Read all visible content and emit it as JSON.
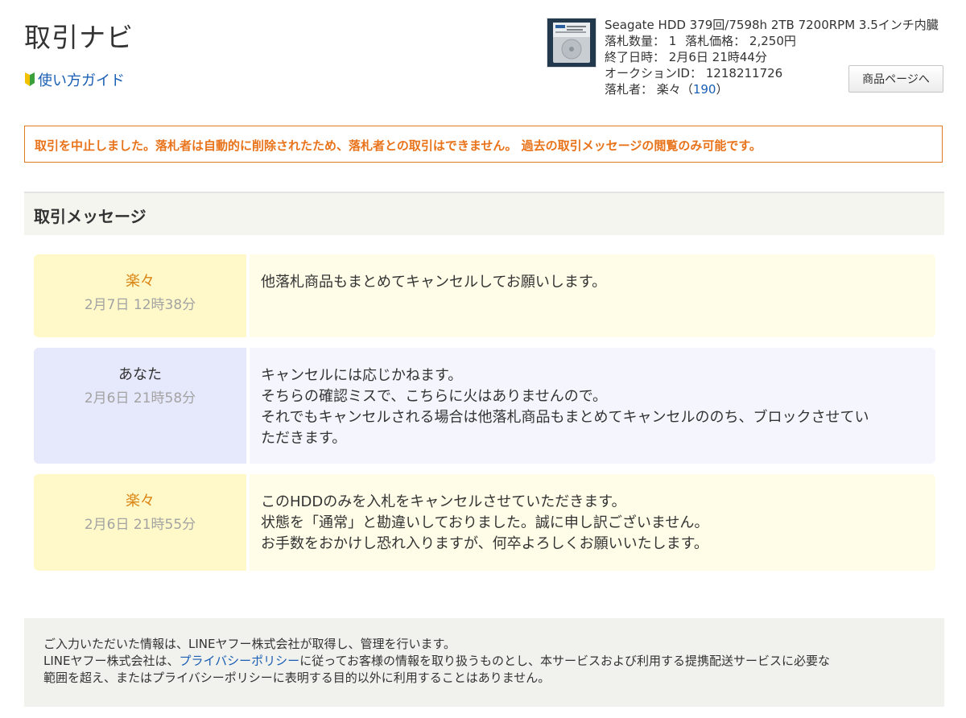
{
  "page": {
    "title": "取引ナビ",
    "guide_link": "使い方ガイド"
  },
  "product": {
    "name": "Seagate HDD 379回/7598h 2TB 7200RPM 3.5インチ内臓",
    "quantity_label": "落札数量：",
    "quantity_value": "1",
    "price_label": "落札価格：",
    "price_value": "2,250円",
    "end_label": "終了日時：",
    "end_value": "2月6日 21時44分",
    "auction_id_label": "オークションID：",
    "auction_id_value": "1218211726",
    "winner_label": "落札者：",
    "winner_name": "楽々",
    "winner_score": "190",
    "item_page_button": "商品ページへ",
    "thumbnail_icon": "hard-drive-image"
  },
  "alert": {
    "text": "取引を中止しました。落札者は自動的に削除されたため、落札者との取引はできません。 過去の取引メッセージの閲覧のみ可能です。",
    "color": "#e8731a"
  },
  "messages_section": {
    "title": "取引メッセージ",
    "items": [
      {
        "sender": "楽々",
        "date": "2月7日 12時38分",
        "lines": [
          "他落札商品もまとめてキャンセルしてお願いします。"
        ]
      },
      {
        "sender": "あなた",
        "date": "2月6日 21時58分",
        "lines": [
          "キャンセルには応じかねます。",
          "そちらの確認ミスで、こちらに火はありませんので。",
          "それでもキャンセルされる場合は他落札商品もまとめてキャンセルののち、ブロックさせてい",
          "ただきます。"
        ]
      },
      {
        "sender": "楽々",
        "date": "2月6日 21時55分",
        "lines": [
          "このHDDのみを入札をキャンセルさせていただきます。",
          "状態を「通常」と勘違いしておりました。誠に申し訳ございません。",
          "お手数をおかけし恐れ入りますが、何卒よろしくお願いいたします。"
        ]
      }
    ]
  },
  "footer": {
    "line1": "ご入力いただいた情報は、LINEヤフー株式会社が取得し、管理を行います。",
    "line2_before": "LINEヤフー株式会社は、",
    "privacy_link": "プライバシーポリシー",
    "line2_after": "に従ってお客様の情報を取り扱うものとし、本サービスおよび利用する提携配送サービスに必要な",
    "line3": "範囲を超え、またはプライバシーポリシーに表明する目的以外に利用することはありません。"
  },
  "colors": {
    "partner_sender_bg": "#fff9c9",
    "partner_body_bg": "#fffde7",
    "self_sender_bg": "#e6e8fc",
    "self_body_bg": "#f5f5fd",
    "link": "#1a5fb4",
    "alert_border": "#e07b1f"
  }
}
